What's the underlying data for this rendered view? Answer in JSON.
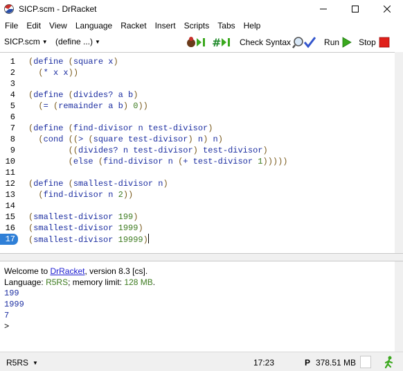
{
  "window": {
    "title": "SICP.scm - DrRacket"
  },
  "menu": [
    "File",
    "Edit",
    "View",
    "Language",
    "Racket",
    "Insert",
    "Scripts",
    "Tabs",
    "Help"
  ],
  "toolbar": {
    "file_name": "SICP.scm",
    "define_menu": "(define ...)",
    "check_syntax": "Check Syntax",
    "run": "Run",
    "stop": "Stop"
  },
  "editor": {
    "line_numbers": [
      "1",
      "2",
      "3",
      "4",
      "5",
      "6",
      "7",
      "8",
      "9",
      "10",
      "11",
      "12",
      "13",
      "14",
      "15",
      "16",
      "17"
    ],
    "highlighted_line": "17",
    "lines": [
      "(define (square x)",
      "  (* x x))",
      "",
      "(define (divides? a b)",
      "  (= (remainder a b) 0))",
      "",
      "(define (find-divisor n test-divisor)",
      "  (cond ((> (square test-divisor) n) n)",
      "        ((divides? n test-divisor) test-divisor)",
      "        (else (find-divisor n (+ test-divisor 1)))))",
      "",
      "(define (smallest-divisor n)",
      "  (find-divisor n 2))",
      "",
      "(smallest-divisor 199)",
      "(smallest-divisor 1999)",
      "(smallest-divisor 19999)"
    ]
  },
  "repl": {
    "welcome_prefix": "Welcome to ",
    "welcome_link": "DrRacket",
    "welcome_suffix": ", version 8.3 [cs].",
    "language_prefix": "Language: ",
    "language_name": "R5RS",
    "language_mid": "; memory limit: ",
    "memory_limit": "128 MB",
    "language_end": ".",
    "outputs": [
      "199",
      "1999",
      "7"
    ],
    "prompt": ">"
  },
  "status": {
    "language": "R5RS",
    "position": "17:23",
    "p_indicator": "P",
    "memory": "378.51 MB"
  },
  "colors": {
    "code": "#1c2ea1",
    "paren": "#7a5a1c",
    "number": "#3c7a1e",
    "highlight": "#2f7fd7",
    "stop": "#e0201a",
    "run": "#3aa81d"
  }
}
